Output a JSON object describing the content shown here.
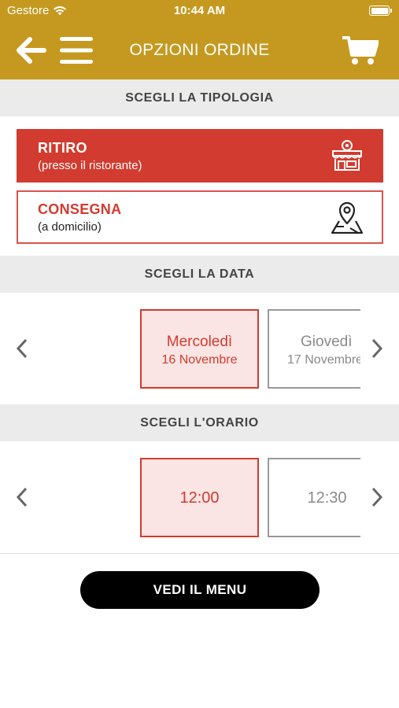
{
  "status_bar": {
    "carrier": "Gestore",
    "time": "10:44 AM",
    "icons": [
      "wifi-icon",
      "battery-icon"
    ]
  },
  "nav": {
    "title": "OPZIONI ORDINE",
    "icons": [
      "back-arrow-icon",
      "hamburger-menu-icon",
      "cart-icon"
    ]
  },
  "colors": {
    "brand": "#c5991f",
    "accent_red": "#d23b2f",
    "selected_bg": "#fbe5e4",
    "section_bg": "#ebebeb",
    "cta_bg": "#000000"
  },
  "order_type": {
    "header": "SCEGLI LA TIPOLOGIA",
    "options": [
      {
        "title": "RITIRO",
        "subtitle": "(presso il ristorante)",
        "icon": "store-icon",
        "selected": true
      },
      {
        "title": "CONSEGNA",
        "subtitle": "(a domicilio)",
        "icon": "map-pin-icon",
        "selected": false
      }
    ]
  },
  "date_picker": {
    "header": "SCEGLI LA DATA",
    "options": [
      {
        "day": "Mercoledì",
        "date": "16 Novembre",
        "selected": true
      },
      {
        "day": "Giovedì",
        "date": "17 Novembre",
        "selected": false
      }
    ]
  },
  "time_picker": {
    "header": "SCEGLI L'ORARIO",
    "options": [
      {
        "time": "12:00",
        "selected": true
      },
      {
        "time": "12:30",
        "selected": false
      }
    ]
  },
  "cta": {
    "label": "VEDI IL MENU"
  }
}
